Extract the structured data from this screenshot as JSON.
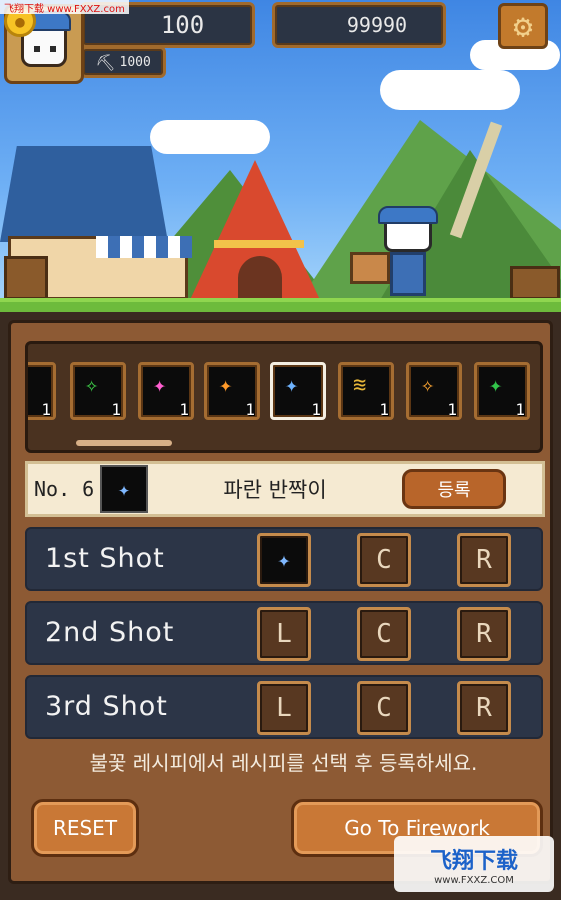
{
  "watermark": {
    "top_text": "飞翔下载 www.FXXZ.com",
    "logo_text": "飞翔下载",
    "logo_url": "www.FXXZ.COM"
  },
  "hud": {
    "hp": "100",
    "pickaxe_count": "1000",
    "coins": "99990",
    "coin_icon": "coin-icon",
    "settings_icon": "gear-icon"
  },
  "recipe_strip": {
    "slots": [
      {
        "icon": "firework-purple",
        "count": "1",
        "color": "#7b4dff",
        "selected": false
      },
      {
        "icon": "firework-green",
        "count": "1",
        "color": "#3fd34a",
        "selected": false
      },
      {
        "icon": "firework-pink",
        "count": "1",
        "color": "#ff5fd0",
        "selected": false
      },
      {
        "icon": "firework-orange",
        "count": "1",
        "color": "#ff9a2a",
        "selected": false
      },
      {
        "icon": "firework-blue",
        "count": "1",
        "color": "#6fb4ff",
        "selected": true
      },
      {
        "icon": "firework-gold-wings",
        "count": "1",
        "color": "#e9b83a",
        "selected": false
      },
      {
        "icon": "firework-orange-dots",
        "count": "1",
        "color": "#ffa733",
        "selected": false
      },
      {
        "icon": "firework-green-dots",
        "count": "1",
        "color": "#32c44a",
        "selected": false
      }
    ]
  },
  "info": {
    "number": "No. 6",
    "name": "파란 반짝이",
    "register_label": "등록"
  },
  "shots": [
    {
      "label": "1st Shot",
      "left": "",
      "center": "C",
      "right": "R"
    },
    {
      "label": "2nd Shot",
      "left": "L",
      "center": "C",
      "right": "R"
    },
    {
      "label": "3rd Shot",
      "left": "L",
      "center": "C",
      "right": "R"
    }
  ],
  "hint": "불꽃 레시피에서 레시피를 선택 후 등록하세요.",
  "buttons": {
    "reset": "RESET",
    "go": "Go To Firework"
  }
}
